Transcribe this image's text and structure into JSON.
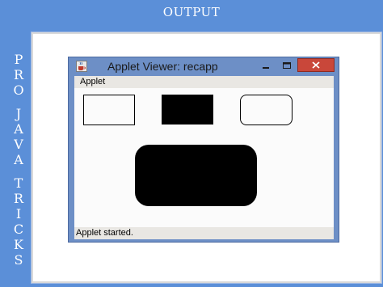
{
  "banner": {
    "title": "OUTPUT"
  },
  "side_text": {
    "words": [
      [
        "P",
        "R",
        "O"
      ],
      [
        "J",
        "A",
        "V",
        "A"
      ],
      [
        "T",
        "R",
        "I",
        "C",
        "K",
        "S"
      ]
    ]
  },
  "window": {
    "title": "Applet Viewer: recapp",
    "icon": "java-cup-icon",
    "controls": {
      "minimize_icon": "minimize-icon",
      "maximize_icon": "maximize-icon",
      "close_icon": "close-icon",
      "close_color": "#c9473a"
    }
  },
  "menu": {
    "items": [
      "Applet"
    ]
  },
  "canvas": {
    "shapes": [
      {
        "kind": "rectangle",
        "style": "outline"
      },
      {
        "kind": "rectangle",
        "style": "filled"
      },
      {
        "kind": "rounded-rectangle",
        "style": "outline"
      },
      {
        "kind": "rounded-rectangle",
        "style": "filled"
      }
    ]
  },
  "status": {
    "text": "Applet started."
  },
  "colors": {
    "background": "#5b8fd8",
    "window_frame": "#6d8fc6",
    "shape_fill": "#000000"
  }
}
